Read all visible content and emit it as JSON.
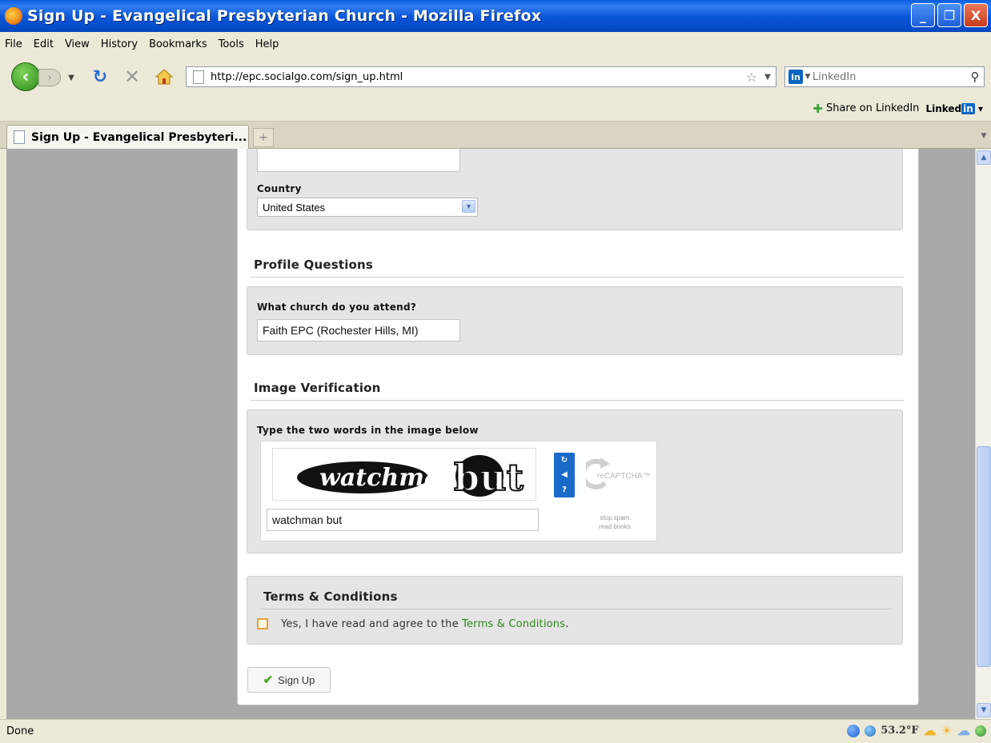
{
  "window": {
    "title": "Sign Up - Evangelical Presbyterian Church - Mozilla Firefox",
    "minimize_label": "_",
    "maximize_label": "❐",
    "close_label": "X"
  },
  "menu": [
    "File",
    "Edit",
    "View",
    "History",
    "Bookmarks",
    "Tools",
    "Help"
  ],
  "nav": {
    "url": "http://epc.socialgo.com/sign_up.html",
    "search_placeholder": "LinkedIn"
  },
  "share_toolbar": {
    "share_label": "Share on LinkedIn",
    "brand_text": "Linked",
    "brand_in": "in"
  },
  "tab": {
    "label": "Sign Up - Evangelical Presbyteri..."
  },
  "form": {
    "country_label": "Country",
    "country_value": "United States",
    "profile_heading": "Profile Questions",
    "church_label": "What church do you attend?",
    "church_value": "Faith EPC (Rochester Hills, MI)",
    "verification_heading": "Image Verification",
    "captcha_label": "Type the two words in the image below",
    "captcha_word1": "watchman",
    "captcha_word2": "but",
    "captcha_value": "watchman but",
    "recaptcha_brand": "reCAPTCHA™",
    "recaptcha_tagline1": "stop spam.",
    "recaptcha_tagline2": "read books.",
    "terms_heading": "Terms & Conditions",
    "terms_text": "Yes, I have read and agree to the",
    "terms_link": "Terms & Conditions",
    "terms_period": ".",
    "signup_label": "Sign Up"
  },
  "status": {
    "text": "Done",
    "temperature": "53.2°F"
  },
  "colors": {
    "titlebar": "#0a55d8",
    "link_green": "#2f8a1e",
    "content_bg": "#a9a9a9"
  }
}
